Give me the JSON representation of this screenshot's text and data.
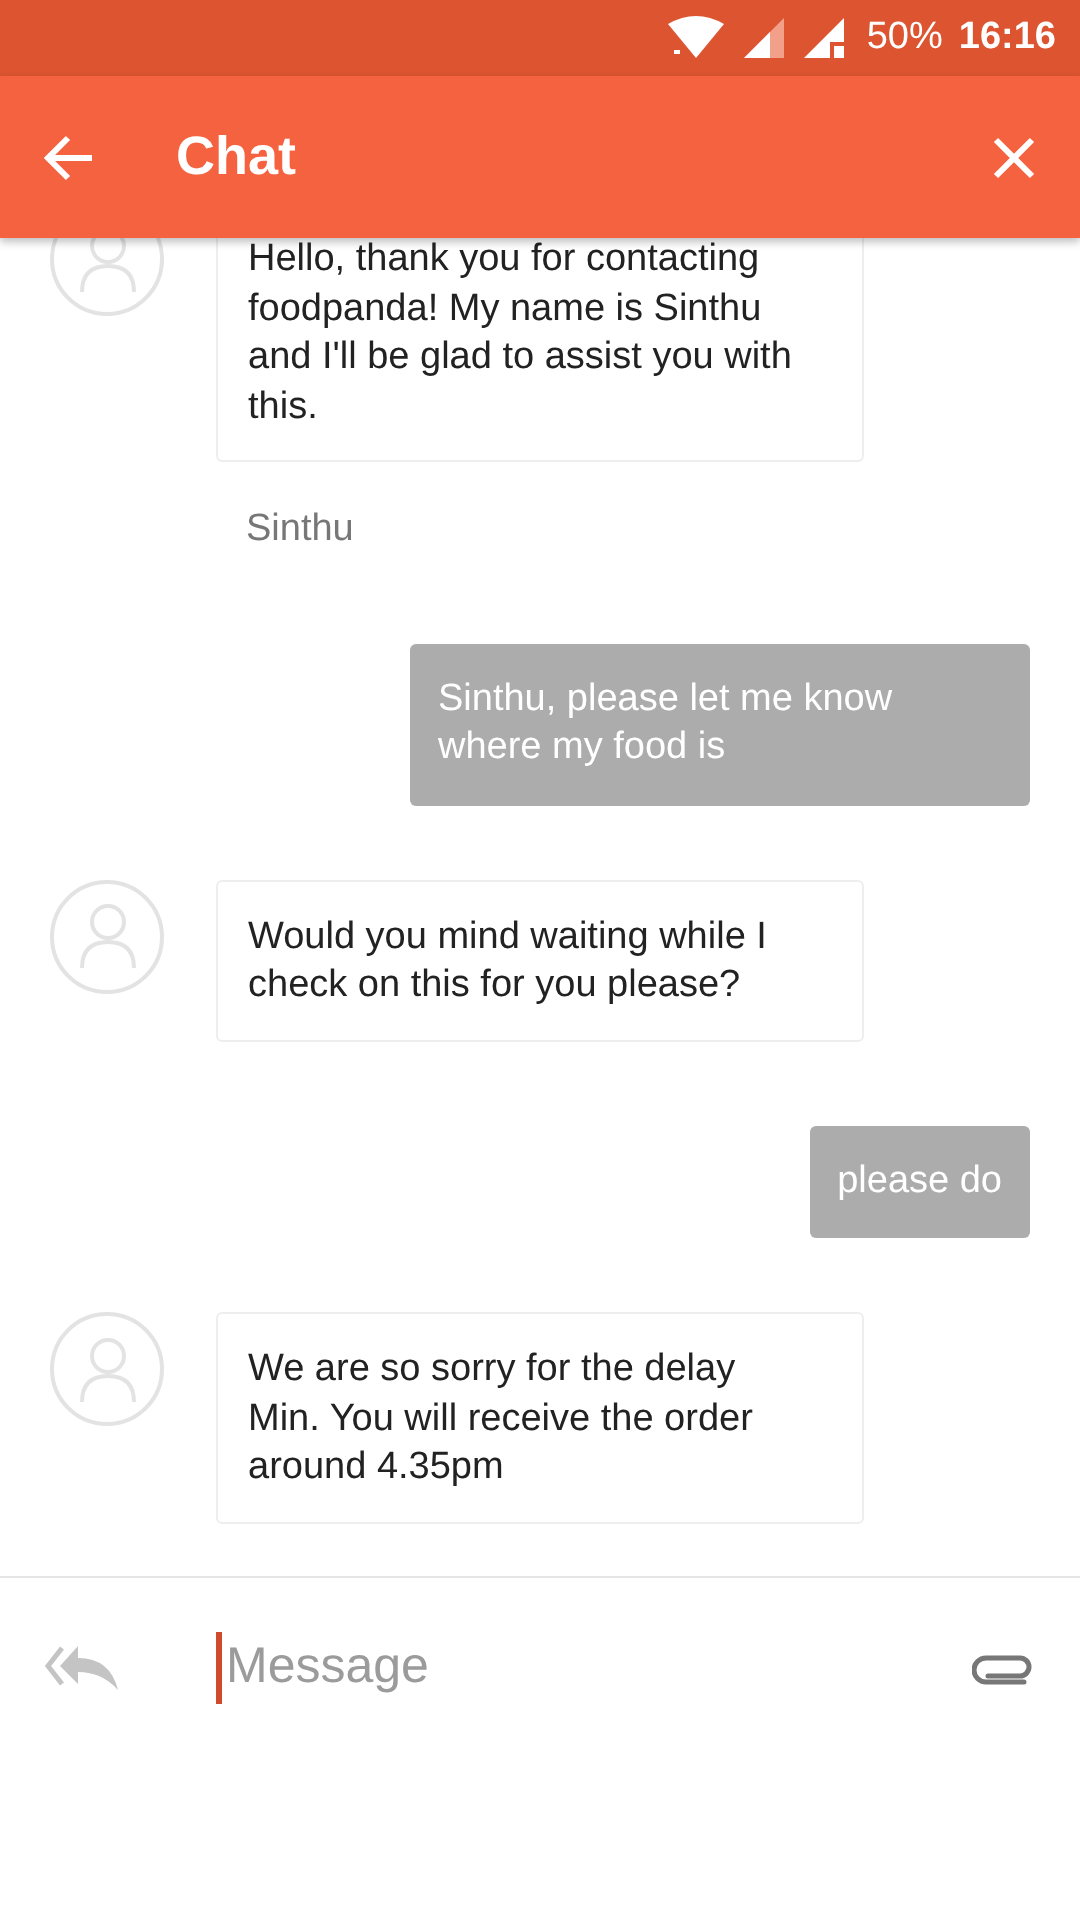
{
  "status_bar": {
    "battery": "50%",
    "time": "16:16"
  },
  "app_bar": {
    "title": "Chat"
  },
  "messages": [
    {
      "kind": "agent",
      "text": "Hello, thank you for contacting foodpanda! My name is Sinthu and I'll be glad to assist you with this.",
      "sender": "Sinthu"
    },
    {
      "kind": "user",
      "text": "Sinthu, please let me know where my food is"
    },
    {
      "kind": "agent",
      "text": "Would you mind waiting while I check on this for you please?"
    },
    {
      "kind": "user",
      "text": "please do"
    },
    {
      "kind": "agent",
      "text": "We are so sorry for the delay Min. You will receive the order around 4.35pm"
    }
  ],
  "composer": {
    "placeholder": "Message",
    "focused": true
  }
}
